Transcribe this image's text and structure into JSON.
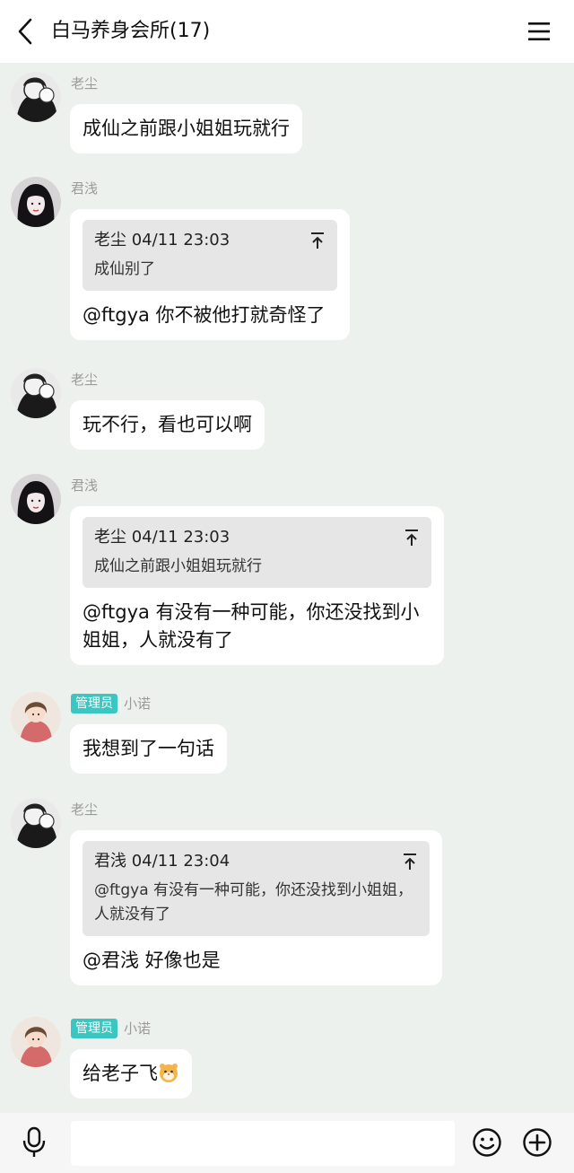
{
  "header": {
    "title": "白马养身会所(17)",
    "back_icon": "chevron-left-icon",
    "menu_icon": "hamburger-menu-icon"
  },
  "messages": [
    {
      "sender": "老尘",
      "text": "成仙之前跟小姐姐玩就行"
    },
    {
      "sender": "君浅",
      "quote": {
        "author": "老尘",
        "time": "04/11 23:03",
        "text": "成仙别了"
      },
      "text": "@ftgya 你不被他打就奇怪了"
    },
    {
      "sender": "老尘",
      "text": "玩不行，看也可以啊"
    },
    {
      "sender": "君浅",
      "quote": {
        "author": "老尘",
        "time": "04/11 23:03",
        "text": "成仙之前跟小姐姐玩就行"
      },
      "text": "@ftgya 有没有一种可能，你还没找到小姐姐，人就没有了"
    },
    {
      "sender": "小诺",
      "role": "管理员",
      "text": "我想到了一句话"
    },
    {
      "sender": "老尘",
      "quote": {
        "author": "君浅",
        "time": "04/11 23:04",
        "text": "@ftgya 有没有一种可能，你还没找到小姐姐，人就没有了"
      },
      "text": "@君浅 好像也是"
    },
    {
      "sender": "小诺",
      "role": "管理员",
      "text": "给老子飞",
      "emoji": "hamster-emoji"
    }
  ],
  "footer": {
    "input_placeholder": "",
    "mic_icon": "microphone-icon",
    "emoji_icon": "smiley-icon",
    "plus_icon": "plus-circle-icon"
  },
  "colors": {
    "background": "#edf1ee",
    "bubble": "#ffffff",
    "quote_bg": "#e6e6e6",
    "admin_badge": "#3cc6c2",
    "sender_name": "#9a9a9a"
  }
}
